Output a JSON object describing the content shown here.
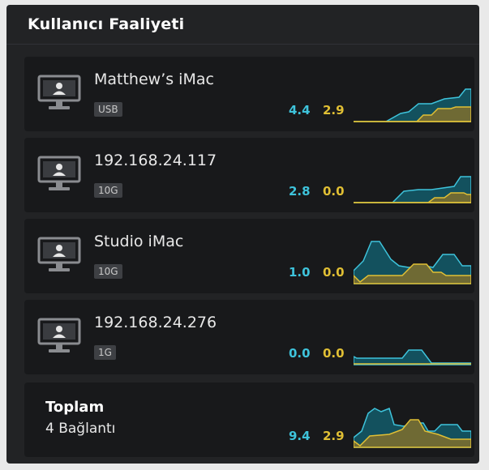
{
  "header": {
    "title": "Kullanıcı Faaliyeti"
  },
  "colors": {
    "upload": "#3ec3db",
    "download": "#e0bf34"
  },
  "connections": [
    {
      "name": "Matthew’s iMac",
      "interface": "USB",
      "upload": "4.4",
      "download": "2.9",
      "icon": "computer-user-icon"
    },
    {
      "name": "192.168.24.117",
      "interface": "10G",
      "upload": "2.8",
      "download": "0.0",
      "icon": "computer-user-icon"
    },
    {
      "name": "Studio iMac",
      "interface": "10G",
      "upload": "1.0",
      "download": "0.0",
      "icon": "computer-user-icon"
    },
    {
      "name": "192.168.24.276",
      "interface": "1G",
      "upload": "0.0",
      "download": "0.0",
      "icon": "computer-user-icon"
    }
  ],
  "total": {
    "title": "Toplam",
    "subtitle": "4 Bağlantı",
    "upload": "9.4",
    "download": "2.9"
  }
}
